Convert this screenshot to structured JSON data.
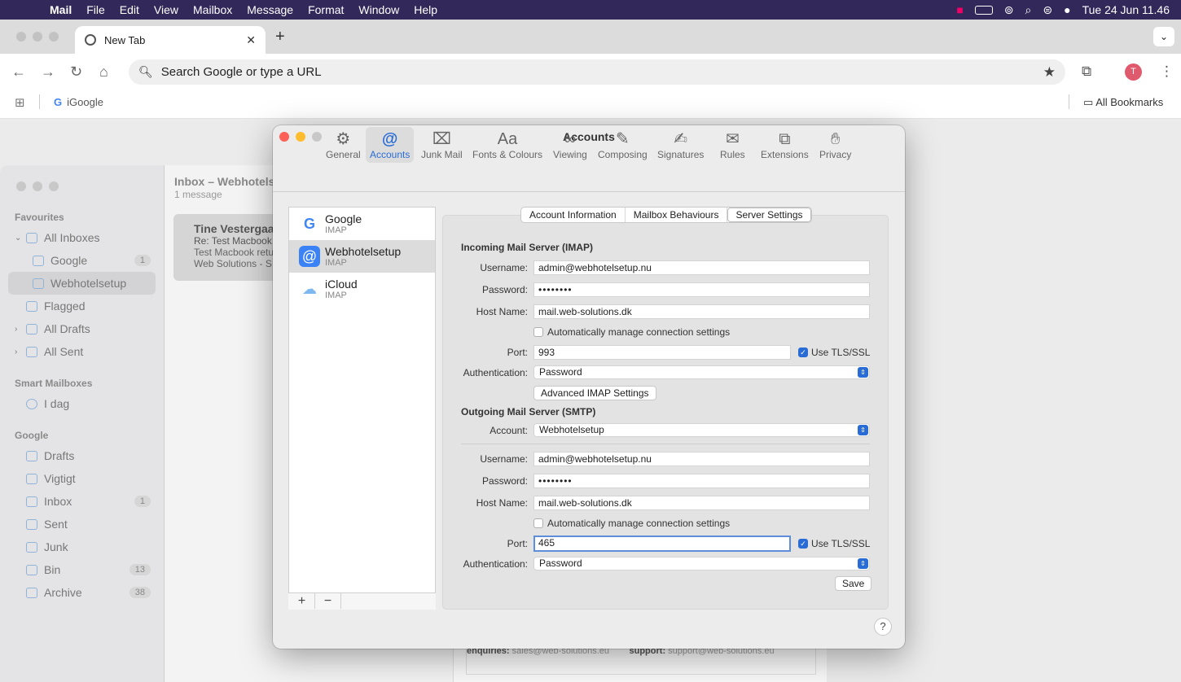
{
  "menubar": {
    "app": "Mail",
    "items": [
      "File",
      "Edit",
      "View",
      "Mailbox",
      "Message",
      "Format",
      "Window",
      "Help"
    ],
    "clock": "Tue 24 Jun  11.46"
  },
  "browser": {
    "tab_title": "New Tab",
    "omnibox_placeholder": "Search Google or type a URL",
    "bookmark_igoogle": "iGoogle",
    "all_bookmarks": "All Bookmarks",
    "avatar_letter": "T"
  },
  "mail": {
    "sidebar": {
      "favourites_header": "Favourites",
      "all_inboxes": "All Inboxes",
      "google": "Google",
      "google_count": "1",
      "webhotelsetup": "Webhotelsetup",
      "flagged": "Flagged",
      "all_drafts": "All Drafts",
      "all_sent": "All Sent",
      "smart_header": "Smart Mailboxes",
      "idag": "I dag",
      "google_header": "Google",
      "drafts": "Drafts",
      "vigtigt": "Vigtigt",
      "inbox": "Inbox",
      "inbox_count": "1",
      "sent": "Sent",
      "junk": "Junk",
      "bin": "Bin",
      "bin_count": "13",
      "archive": "Archive",
      "archive_count": "38"
    },
    "list": {
      "title": "Inbox – Webhotels",
      "subtitle": "1 message",
      "row_from": "Tine Vestergaa",
      "row_subject": "Re: Test Macbook",
      "row_preview1": "Test Macbook retu",
      "row_preview2": "Web Solutions - S"
    },
    "footer": {
      "enquiries_label": "enquiries:",
      "enquiries_value": "sales@web-solutions.eu",
      "support_label": "support:",
      "support_value": "support@web-solutions.eu"
    }
  },
  "dialog": {
    "title": "Accounts",
    "toolbar": [
      "General",
      "Accounts",
      "Junk Mail",
      "Fonts & Colours",
      "Viewing",
      "Composing",
      "Signatures",
      "Rules",
      "Extensions",
      "Privacy"
    ],
    "accounts": [
      {
        "name": "Google",
        "type": "IMAP"
      },
      {
        "name": "Webhotelsetup",
        "type": "IMAP"
      },
      {
        "name": "iCloud",
        "type": "IMAP"
      }
    ],
    "tabs": [
      "Account Information",
      "Mailbox Behaviours",
      "Server Settings"
    ],
    "incoming": {
      "header": "Incoming Mail Server (IMAP)",
      "username_label": "Username:",
      "username": "admin@webhotelsetup.nu",
      "password_label": "Password:",
      "password": "••••••••",
      "host_label": "Host Name:",
      "host": "mail.web-solutions.dk",
      "auto_label": "Automatically manage connection settings",
      "port_label": "Port:",
      "port": "993",
      "tls_label": "Use TLS/SSL",
      "auth_label": "Authentication:",
      "auth": "Password",
      "advanced_button": "Advanced IMAP Settings"
    },
    "outgoing": {
      "header": "Outgoing Mail Server (SMTP)",
      "account_label": "Account:",
      "account": "Webhotelsetup",
      "username_label": "Username:",
      "username": "admin@webhotelsetup.nu",
      "password_label": "Password:",
      "password": "••••••••",
      "host_label": "Host Name:",
      "host": "mail.web-solutions.dk",
      "auto_label": "Automatically manage connection settings",
      "port_label": "Port:",
      "port": "465",
      "tls_label": "Use TLS/SSL",
      "auth_label": "Authentication:",
      "auth": "Password"
    },
    "save_button": "Save",
    "help": "?",
    "add": "+",
    "remove": "−"
  },
  "colors": {
    "accent": "#2a6cd6",
    "menubar": "#33285a",
    "close": "#fe5f57",
    "minimize": "#febc2e",
    "zoom": "#c8c8c8"
  }
}
